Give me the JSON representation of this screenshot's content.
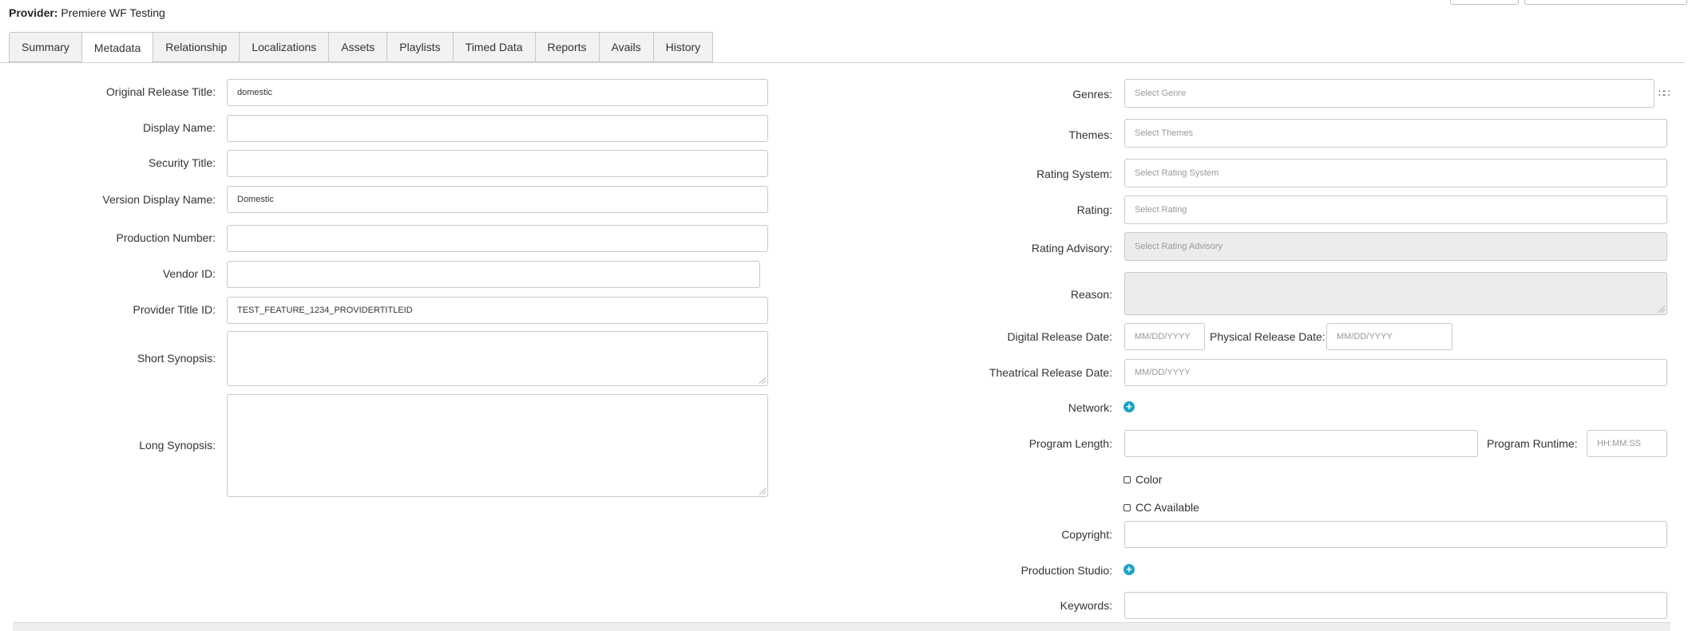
{
  "provider": {
    "label": "Provider:",
    "name": "Premiere WF Testing"
  },
  "tabs": [
    "Summary",
    "Metadata",
    "Relationship",
    "Localizations",
    "Assets",
    "Playlists",
    "Timed Data",
    "Reports",
    "Avails",
    "History"
  ],
  "left": {
    "original_release_title": {
      "label": "Original Release Title:",
      "value": "domestic"
    },
    "display_name": {
      "label": "Display Name:",
      "value": ""
    },
    "security_title": {
      "label": "Security Title:",
      "value": ""
    },
    "version_display_name": {
      "label": "Version Display Name:",
      "value": "Domestic"
    },
    "production_number": {
      "label": "Production Number:",
      "value": ""
    },
    "vendor_id": {
      "label": "Vendor ID:",
      "value": ""
    },
    "provider_title_id": {
      "label": "Provider Title ID:",
      "value": "TEST_FEATURE_1234_PROVIDERTITLEID"
    },
    "short_synopsis": {
      "label": "Short Synopsis:",
      "value": ""
    },
    "long_synopsis": {
      "label": "Long Synopsis:",
      "value": ""
    }
  },
  "right": {
    "genres": {
      "label": "Genres:",
      "placeholder": "Select Genre"
    },
    "themes": {
      "label": "Themes:",
      "placeholder": "Select Themes"
    },
    "rating_system": {
      "label": "Rating System:",
      "placeholder": "Select Rating System"
    },
    "rating": {
      "label": "Rating:",
      "placeholder": "Select Rating"
    },
    "rating_advisory": {
      "label": "Rating Advisory:",
      "placeholder": "Select Rating Advisory"
    },
    "reason": {
      "label": "Reason:",
      "value": ""
    },
    "digital_release_date": {
      "label": "Digital Release Date:",
      "placeholder": "MM/DD/YYYY"
    },
    "physical_release_date": {
      "label": "Physical Release Date:",
      "placeholder": "MM/DD/YYYY"
    },
    "theatrical_release_date": {
      "label": "Theatrical Release Date:",
      "placeholder": "MM/DD/YYYY"
    },
    "network": {
      "label": "Network:"
    },
    "program_length": {
      "label": "Program Length:",
      "value": ""
    },
    "program_runtime": {
      "label": "Program Runtime:",
      "placeholder": "HH:MM:SS"
    },
    "color": {
      "label": "Color"
    },
    "cc_available": {
      "label": "CC Available"
    },
    "copyright": {
      "label": "Copyright:",
      "value": ""
    },
    "production_studio": {
      "label": "Production Studio:"
    },
    "keywords": {
      "label": "Keywords:",
      "value": ""
    }
  },
  "icons": {
    "plus": "+",
    "grid": "∷∷"
  },
  "colors": {
    "accent": "#1ea1c7"
  }
}
